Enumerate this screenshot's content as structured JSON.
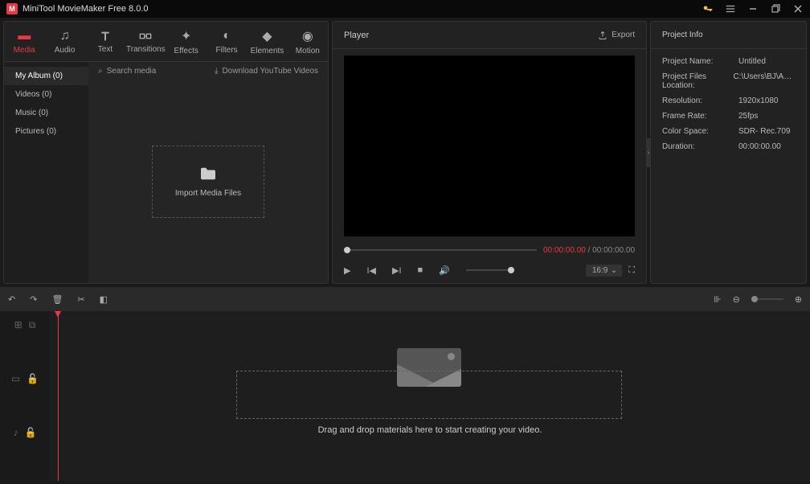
{
  "app": {
    "title": "MiniTool MovieMaker Free 8.0.0"
  },
  "tabs": [
    {
      "label": "Media"
    },
    {
      "label": "Audio"
    },
    {
      "label": "Text"
    },
    {
      "label": "Transitions"
    },
    {
      "label": "Effects"
    },
    {
      "label": "Filters"
    },
    {
      "label": "Elements"
    },
    {
      "label": "Motion"
    }
  ],
  "sidebar": [
    {
      "label": "My Album (0)"
    },
    {
      "label": "Videos (0)"
    },
    {
      "label": "Music (0)"
    },
    {
      "label": "Pictures (0)"
    }
  ],
  "search": {
    "placeholder": "Search media"
  },
  "download": {
    "label": "Download YouTube Videos"
  },
  "import": {
    "label": "Import Media Files"
  },
  "player": {
    "title": "Player",
    "export": "Export",
    "current": "00:00:00.00",
    "total": "00:00:00.00",
    "aspect": "16:9"
  },
  "info": {
    "title": "Project Info",
    "rows": [
      {
        "label": "Project Name:",
        "value": "Untitled"
      },
      {
        "label": "Project Files Location:",
        "value": "C:\\Users\\BJ\\App..."
      },
      {
        "label": "Resolution:",
        "value": "1920x1080"
      },
      {
        "label": "Frame Rate:",
        "value": "25fps"
      },
      {
        "label": "Color Space:",
        "value": "SDR- Rec.709"
      },
      {
        "label": "Duration:",
        "value": "00:00:00.00"
      }
    ]
  },
  "timeline": {
    "dropText": "Drag and drop materials here to start creating your video."
  }
}
